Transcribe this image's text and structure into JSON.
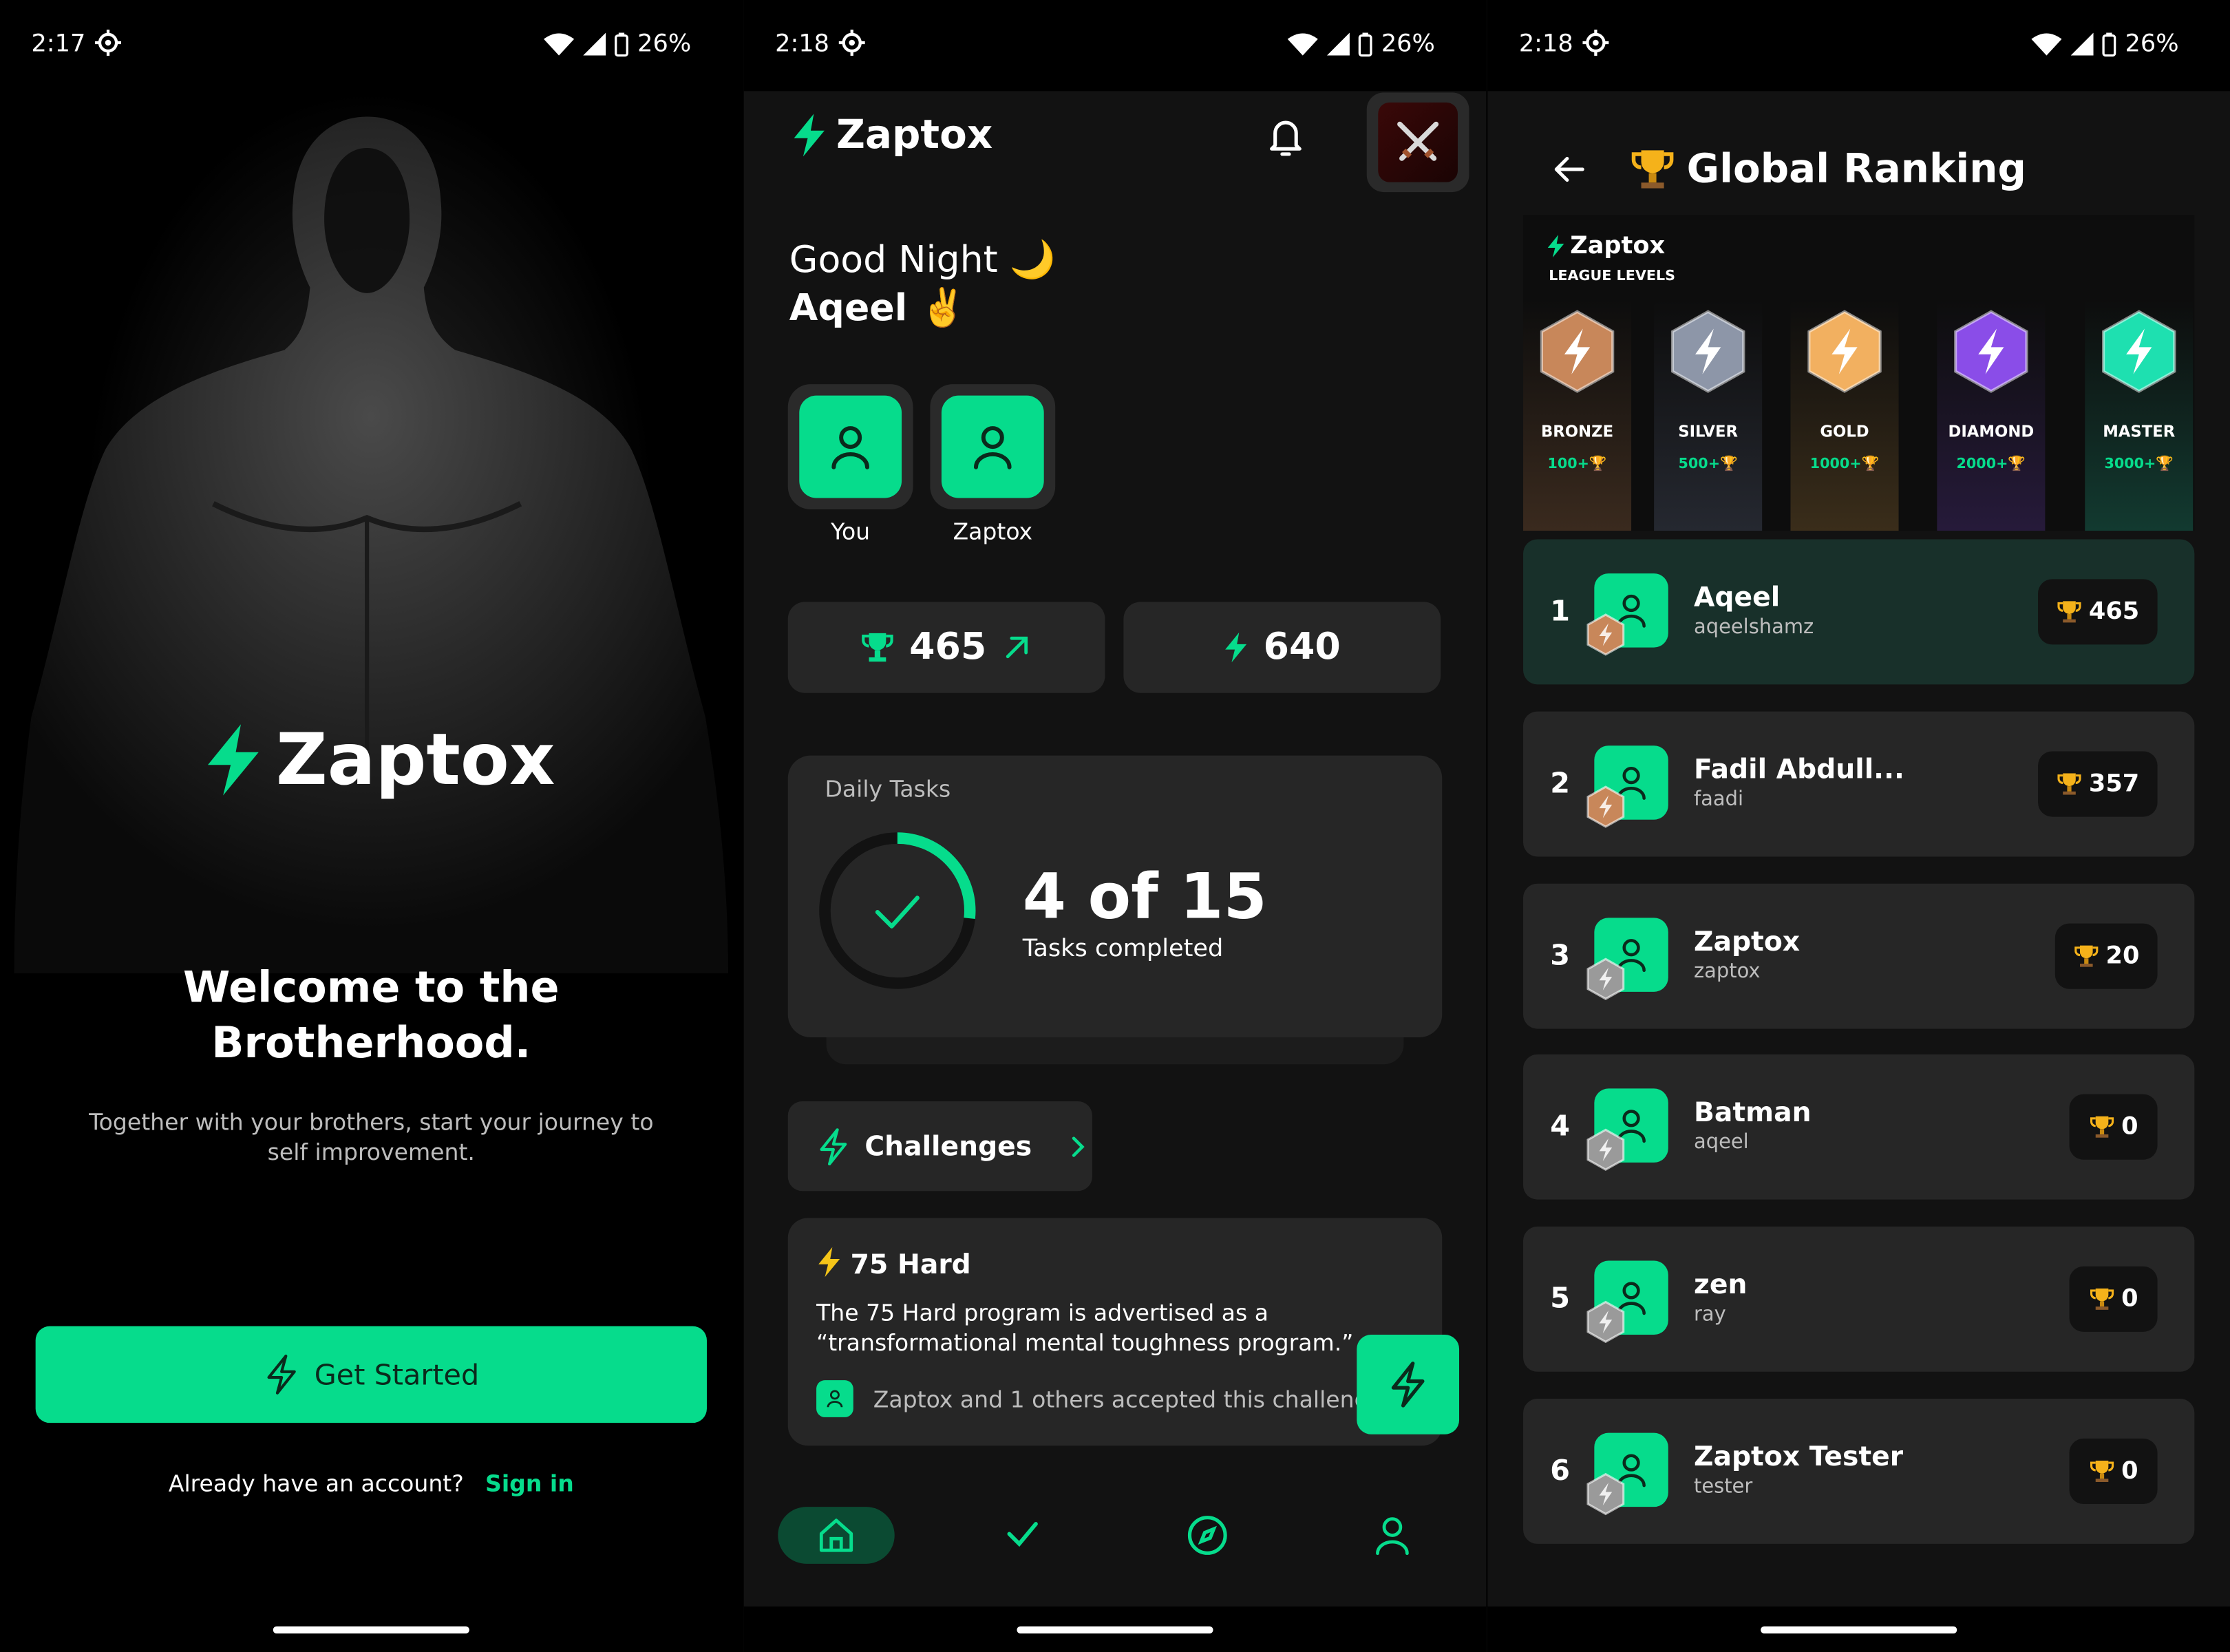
{
  "colors": {
    "accent": "#06DC8C",
    "bg": "#121212",
    "card": "#262626"
  },
  "screen1": {
    "status": {
      "time": "2:17",
      "battery": "26%"
    },
    "logo": "Zaptox",
    "welcome_line1": "Welcome to the",
    "welcome_line2": "Brotherhood.",
    "subtitle": "Together with your brothers, start your journey to self improvement.",
    "get_started": "Get Started",
    "have_account": "Already have an account?",
    "sign_in": "Sign in"
  },
  "screen2": {
    "status": {
      "time": "2:18",
      "battery": "26%"
    },
    "logo": "Zaptox",
    "greeting": "Good Night 🌙",
    "name": "Aqeel ✌️",
    "chips": [
      {
        "label": "You"
      },
      {
        "label": "Zaptox"
      }
    ],
    "trophies": "465",
    "energy": "640",
    "daily_tasks_title": "Daily Tasks",
    "tasks_done": 4,
    "tasks_total": 15,
    "tasks_count": "4 of 15",
    "tasks_completed": "Tasks completed",
    "challenges": "Challenges",
    "challenge": {
      "title": "75 Hard",
      "description": "The 75 Hard program is advertised as a “transformational mental toughness program.”",
      "accepted": "Zaptox and 1 others accepted this challenge"
    },
    "nav": [
      "home-icon",
      "check-icon",
      "compass-icon",
      "profile-icon"
    ]
  },
  "screen3": {
    "status": {
      "time": "2:18",
      "battery": "26%"
    },
    "title": "Global Ranking",
    "league_logo": "Zaptox",
    "league_sub": "LEAGUE LEVELS",
    "tiers": [
      {
        "name": "BRONZE",
        "pts": "100+🏆",
        "color": "#C8875A"
      },
      {
        "name": "SILVER",
        "pts": "500+🏆",
        "color": "#8D96A8"
      },
      {
        "name": "GOLD",
        "pts": "1000+🏆",
        "color": "#F2B060"
      },
      {
        "name": "DIAMOND",
        "pts": "2000+🏆",
        "color": "#8A4DE8"
      },
      {
        "name": "MASTER",
        "pts": "3000+🏆",
        "color": "#1EE0B0"
      }
    ],
    "ranking": [
      {
        "rank": "1",
        "name": "Aqeel",
        "user": "aqeelshamz",
        "score": "465",
        "badge": "bronze"
      },
      {
        "rank": "2",
        "name": "Fadil Abdull...",
        "user": "faadi",
        "score": "357",
        "badge": "bronze"
      },
      {
        "rank": "3",
        "name": "Zaptox",
        "user": "zaptox",
        "score": "20",
        "badge": "none"
      },
      {
        "rank": "4",
        "name": "Batman",
        "user": "aqeel",
        "score": "0",
        "badge": "none"
      },
      {
        "rank": "5",
        "name": "zen",
        "user": "ray",
        "score": "0",
        "badge": "none"
      },
      {
        "rank": "6",
        "name": "Zaptox Tester",
        "user": "tester",
        "score": "0",
        "badge": "none"
      }
    ]
  }
}
